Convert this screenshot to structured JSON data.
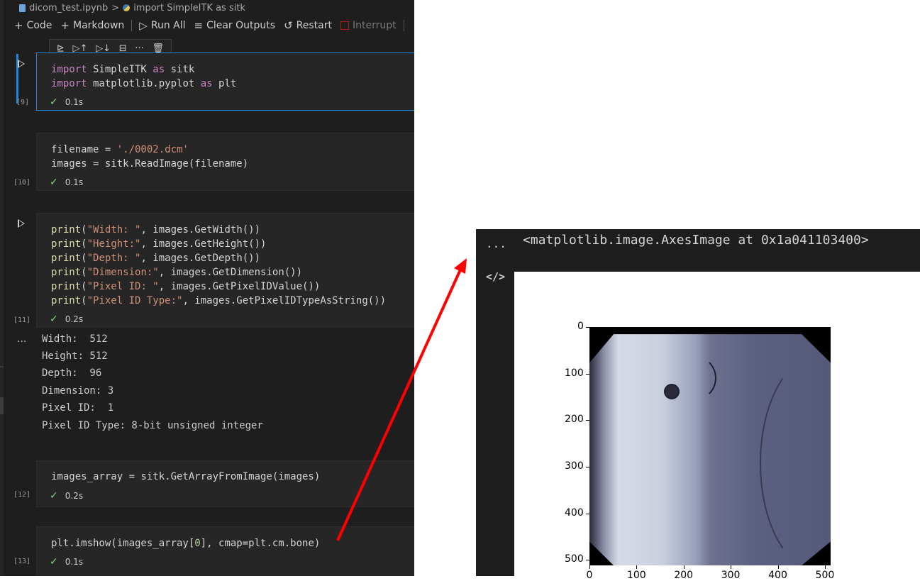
{
  "breadcrumb": {
    "file": "dicom_test.ipynb",
    "separator": ">",
    "cell": "import SimpleITK as sitk"
  },
  "toolbar": {
    "code": "Code",
    "markdown": "Markdown",
    "run_all": "Run All",
    "clear_outputs": "Clear Outputs",
    "restart": "Restart",
    "interrupt": "Interrupt"
  },
  "cell_toolbar_icons": [
    "run-by-line-icon",
    "execute-above-icon",
    "execute-below-icon",
    "split-cell-icon",
    "more-icon",
    "delete-icon"
  ],
  "cells": [
    {
      "exec": "[9]",
      "time": "0.1s",
      "lines": [
        [
          {
            "c": "kw",
            "t": "import"
          },
          {
            "c": "",
            "t": " SimpleITK "
          },
          {
            "c": "kw",
            "t": "as"
          },
          {
            "c": "",
            "t": " sitk"
          }
        ],
        [
          {
            "c": "kw",
            "t": "import"
          },
          {
            "c": "",
            "t": " matplotlib.pyplot "
          },
          {
            "c": "kw",
            "t": "as"
          },
          {
            "c": "",
            "t": " plt"
          }
        ]
      ]
    },
    {
      "exec": "[10]",
      "time": "0.1s",
      "lines": [
        [
          {
            "c": "",
            "t": "filename = "
          },
          {
            "c": "str",
            "t": "'./0002.dcm'"
          }
        ],
        [
          {
            "c": "",
            "t": "images = sitk.ReadImage(filename)"
          }
        ]
      ]
    },
    {
      "exec": "[11]",
      "time": "0.2s",
      "lines": [
        [
          {
            "c": "fn",
            "t": "print"
          },
          {
            "c": "",
            "t": "("
          },
          {
            "c": "str",
            "t": "\"Width: \""
          },
          {
            "c": "",
            "t": ", images.GetWidth())"
          }
        ],
        [
          {
            "c": "fn",
            "t": "print"
          },
          {
            "c": "",
            "t": "("
          },
          {
            "c": "str",
            "t": "\"Height:\""
          },
          {
            "c": "",
            "t": ", images.GetHeight())"
          }
        ],
        [
          {
            "c": "fn",
            "t": "print"
          },
          {
            "c": "",
            "t": "("
          },
          {
            "c": "str",
            "t": "\"Depth: \""
          },
          {
            "c": "",
            "t": ", images.GetDepth())"
          }
        ],
        [
          {
            "c": "fn",
            "t": "print"
          },
          {
            "c": "",
            "t": "("
          },
          {
            "c": "str",
            "t": "\"Dimension:\""
          },
          {
            "c": "",
            "t": ", images.GetDimension())"
          }
        ],
        [
          {
            "c": "fn",
            "t": "print"
          },
          {
            "c": "",
            "t": "("
          },
          {
            "c": "str",
            "t": "\"Pixel ID: \""
          },
          {
            "c": "",
            "t": ", images.GetPixelIDValue())"
          }
        ],
        [
          {
            "c": "fn",
            "t": "print"
          },
          {
            "c": "",
            "t": "("
          },
          {
            "c": "str",
            "t": "\"Pixel ID Type:\""
          },
          {
            "c": "",
            "t": ", images.GetPixelIDTypeAsString())"
          }
        ]
      ],
      "output": [
        "Width:  512",
        "Height: 512",
        "Depth:  96",
        "Dimension: 3",
        "Pixel ID:  1",
        "Pixel ID Type: 8-bit unsigned integer"
      ]
    },
    {
      "exec": "[12]",
      "time": "0.2s",
      "lines": [
        [
          {
            "c": "",
            "t": "images_array = sitk.GetArrayFromImage(images)"
          }
        ]
      ]
    },
    {
      "exec": "[13]",
      "time": "0.1s",
      "lines": [
        [
          {
            "c": "",
            "t": "plt.imshow(images_array["
          },
          {
            "c": "num",
            "t": "0"
          },
          {
            "c": "",
            "t": "], cmap=plt.cm.bone)"
          }
        ]
      ]
    }
  ],
  "output_panel": {
    "ellipsis": "...",
    "repr": "<matplotlib.image.AxesImage at 0x1a041103400>",
    "code_icon": "</>"
  },
  "plot": {
    "y_ticks": [
      "0",
      "100",
      "200",
      "300",
      "400",
      "500"
    ],
    "x_ticks": [
      "0",
      "100",
      "200",
      "300",
      "400",
      "500"
    ],
    "extent": [
      0,
      512,
      512,
      0
    ],
    "cmap": "bone"
  },
  "colors": {
    "accent": "#1e88e5",
    "success": "#89d185",
    "arrow": "#ff0000"
  }
}
